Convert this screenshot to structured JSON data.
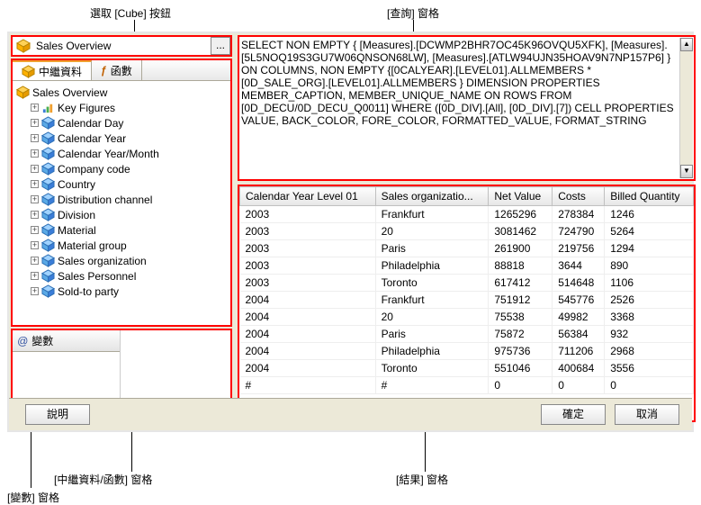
{
  "labels": {
    "select_cube": "選取 [Cube] 按鈕",
    "query_pane": "[查詢] 窗格",
    "meta_func_pane": "[中繼資料/函數] 窗格",
    "result_pane": "[結果] 窗格",
    "vars_pane": "[變數] 窗格"
  },
  "cube": {
    "title": "Sales Overview",
    "button": "..."
  },
  "tabs": {
    "metadata": "中繼資料",
    "functions": "函數"
  },
  "tree": {
    "root": "Sales Overview",
    "items": [
      "Key Figures",
      "Calendar Day",
      "Calendar Year",
      "Calendar Year/Month",
      "Company code",
      "Country",
      "Distribution channel",
      "Division",
      "Material",
      "Material group",
      "Sales organization",
      "Sales Personnel",
      "Sold-to party"
    ]
  },
  "vars": {
    "header": "變數"
  },
  "query": "SELECT NON EMPTY { [Measures].[DCWMP2BHR7OC45K96OVQU5XFK], [Measures].[5L5NOQ19S3GU7W06QNSON68LW], [Measures].[ATLW94UJN35HOAV9N7NP157P6] } ON COLUMNS, NON EMPTY {[0CALYEAR].[LEVEL01].ALLMEMBERS * [0D_SALE_ORG].[LEVEL01].ALLMEMBERS } DIMENSION PROPERTIES MEMBER_CAPTION, MEMBER_UNIQUE_NAME ON ROWS FROM [0D_DECU/0D_DECU_Q0011] WHERE ([0D_DIV].[All], [0D_DIV].[7]) CELL PROPERTIES VALUE, BACK_COLOR, FORE_COLOR, FORMATTED_VALUE, FORMAT_STRING",
  "grid": {
    "headers": [
      "Calendar Year Level 01",
      "Sales organizatio...",
      "Net Value",
      "Costs",
      "Billed Quantity"
    ],
    "rows": [
      [
        "2003",
        "Frankfurt",
        "1265296",
        "278384",
        "1246"
      ],
      [
        "2003",
        "20",
        "3081462",
        "724790",
        "5264"
      ],
      [
        "2003",
        "Paris",
        "261900",
        "219756",
        "1294"
      ],
      [
        "2003",
        "Philadelphia",
        "88818",
        "3644",
        "890"
      ],
      [
        "2003",
        "Toronto",
        "617412",
        "514648",
        "1106"
      ],
      [
        "2004",
        "Frankfurt",
        "751912",
        "545776",
        "2526"
      ],
      [
        "2004",
        "20",
        "75538",
        "49982",
        "3368"
      ],
      [
        "2004",
        "Paris",
        "75872",
        "56384",
        "932"
      ],
      [
        "2004",
        "Philadelphia",
        "975736",
        "711206",
        "2968"
      ],
      [
        "2004",
        "Toronto",
        "551046",
        "400684",
        "3556"
      ],
      [
        "#",
        "#",
        "0",
        "0",
        "0"
      ]
    ]
  },
  "buttons": {
    "help": "說明",
    "ok": "確定",
    "cancel": "取消"
  },
  "chart_data": {
    "type": "table",
    "columns": [
      "Calendar Year Level 01",
      "Sales organization",
      "Net Value",
      "Costs",
      "Billed Quantity"
    ],
    "rows": [
      {
        "year": "2003",
        "org": "Frankfurt",
        "net": 1265296,
        "costs": 278384,
        "qty": 1246
      },
      {
        "year": "2003",
        "org": "20",
        "net": 3081462,
        "costs": 724790,
        "qty": 5264
      },
      {
        "year": "2003",
        "org": "Paris",
        "net": 261900,
        "costs": 219756,
        "qty": 1294
      },
      {
        "year": "2003",
        "org": "Philadelphia",
        "net": 88818,
        "costs": 3644,
        "qty": 890
      },
      {
        "year": "2003",
        "org": "Toronto",
        "net": 617412,
        "costs": 514648,
        "qty": 1106
      },
      {
        "year": "2004",
        "org": "Frankfurt",
        "net": 751912,
        "costs": 545776,
        "qty": 2526
      },
      {
        "year": "2004",
        "org": "20",
        "net": 75538,
        "costs": 49982,
        "qty": 3368
      },
      {
        "year": "2004",
        "org": "Paris",
        "net": 75872,
        "costs": 56384,
        "qty": 932
      },
      {
        "year": "2004",
        "org": "Philadelphia",
        "net": 975736,
        "costs": 711206,
        "qty": 2968
      },
      {
        "year": "2004",
        "org": "Toronto",
        "net": 551046,
        "costs": 400684,
        "qty": 3556
      }
    ]
  }
}
